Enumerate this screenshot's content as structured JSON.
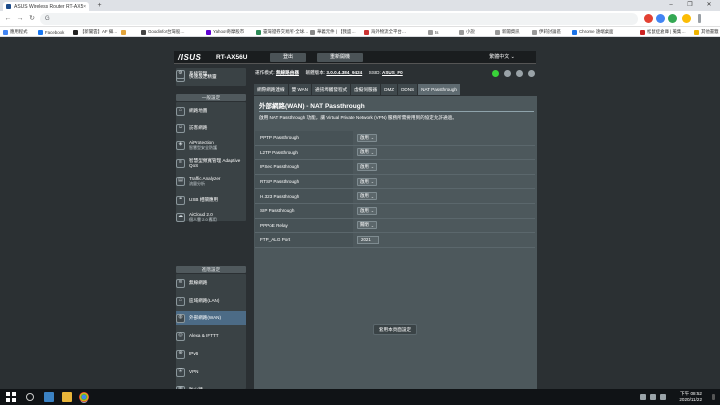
{
  "browser": {
    "tab_title": "ASUS Wireless Router RT-AX5…",
    "tab_close": "×",
    "new_tab": "+",
    "url": "G",
    "window_controls": [
      "–",
      "❐",
      "✕"
    ],
    "nav": {
      "back": "←",
      "forward": "→",
      "reload": "↻"
    },
    "bookmarks": [
      {
        "label": "應用程式",
        "color": "#4285f4"
      },
      {
        "label": "Facebook",
        "color": "#1877f2"
      },
      {
        "label": "【新聞雲】AF 攝…",
        "color": "#222222"
      },
      {
        "label": "",
        "color": "#e2a43b"
      },
      {
        "label": "Goodinfo!台灣股…",
        "color": "#444444"
      },
      {
        "label": "Yahoo!奇摩股市",
        "color": "#6001d2"
      },
      {
        "label": "臺灣證券交易所-全球…",
        "color": "#2e8b57"
      },
      {
        "label": "華義元件 | 【我盛…",
        "color": "#888888"
      },
      {
        "label": "海外物流全平台…",
        "color": "#cc3333"
      },
      {
        "label": "ts",
        "color": "#999999"
      },
      {
        "label": "小說",
        "color": "#999999"
      },
      {
        "label": "新聞資訊",
        "color": "#999999"
      },
      {
        "label": "伊莉討論區",
        "color": "#999999"
      },
      {
        "label": "Chrome 遠端桌面",
        "color": "#1a73e8"
      },
      {
        "label": "松鼠症倉庫 | 蒐集…",
        "color": "#cc2222"
      },
      {
        "label": "其他書籤",
        "color": "#f0b400"
      }
    ]
  },
  "header": {
    "brand": "/ISUS",
    "model": "RT-AX56U",
    "logout": "登出",
    "reboot": "重新開機",
    "language": "繁體中文 ⌄"
  },
  "status": {
    "op_mode_label": "運作模式:",
    "op_mode_value": "無線路由器",
    "fw_label": "韌體版本:",
    "fw_value": "3.0.0.4.384_9424",
    "ssid_label": "SSID:",
    "ssid_value": "ASUS_F0"
  },
  "sidebar": {
    "quick_setup": "快速設定精靈",
    "general_header": "一般設定",
    "general_items": [
      {
        "label": "網路地圖",
        "sub": "",
        "icon": "network-map-icon",
        "glyph": "⌂"
      },
      {
        "label": "訪客網路",
        "sub": "",
        "icon": "guest-network-icon",
        "glyph": "☺"
      },
      {
        "label": "AiProtection",
        "sub": "智慧型安全防護",
        "icon": "shield-icon",
        "glyph": "◈"
      },
      {
        "label": "智慧型頻寬管理 Adaptive QoS",
        "sub": "",
        "icon": "qos-icon",
        "glyph": "≡"
      },
      {
        "label": "Traffic Analyzer",
        "sub": "流量分析",
        "icon": "traffic-analyzer-icon",
        "glyph": "▤"
      },
      {
        "label": "USB 相關應用",
        "sub": "",
        "icon": "usb-icon",
        "glyph": "⚭"
      },
      {
        "label": "AiCloud 2.0",
        "sub": "個人雲 2.0 應用",
        "icon": "cloud-icon",
        "glyph": "☁"
      }
    ],
    "advanced_header": "進階設定",
    "advanced_items": [
      {
        "label": "無線網路",
        "sub": "",
        "icon": "wireless-icon",
        "glyph": "≋",
        "active": false
      },
      {
        "label": "區域網路(LAN)",
        "sub": "",
        "icon": "lan-icon",
        "glyph": "⌂",
        "active": false
      },
      {
        "label": "外部網路(WAN)",
        "sub": "",
        "icon": "wan-icon",
        "glyph": "◍",
        "active": true
      },
      {
        "label": "Alexa & IFTTT",
        "sub": "",
        "icon": "alexa-icon",
        "glyph": "◎",
        "active": false
      },
      {
        "label": "IPv6",
        "sub": "",
        "icon": "ipv6-icon",
        "glyph": "⊕",
        "active": false
      },
      {
        "label": "VPN",
        "sub": "",
        "icon": "vpn-icon",
        "glyph": "⛨",
        "active": false
      },
      {
        "label": "防火牆",
        "sub": "",
        "icon": "firewall-icon",
        "glyph": "▦",
        "active": false
      },
      {
        "label": "系統管理",
        "sub": "",
        "icon": "admin-icon",
        "glyph": "⚙",
        "active": false
      }
    ]
  },
  "subtabs": [
    {
      "label": "網際網路連線",
      "active": false
    },
    {
      "label": "雙 WAN",
      "active": false
    },
    {
      "label": "通訊埠觸發程式",
      "active": false
    },
    {
      "label": "虛擬伺服器",
      "active": false
    },
    {
      "label": "DMZ",
      "active": false
    },
    {
      "label": "DDNS",
      "active": false
    },
    {
      "label": "NAT Passthrough",
      "active": true
    }
  ],
  "panel": {
    "title": "外部網路(WAN) - NAT Passthrough",
    "description": "啟用 NAT Passthrough 功能，讓 Virtual Private Network (VPN) 服務所需要用到的協定允許通過。",
    "settings": [
      {
        "label": "PPTP Passthrough",
        "type": "select",
        "value": "啟用"
      },
      {
        "label": "L2TP Passthrough",
        "type": "select",
        "value": "啟用"
      },
      {
        "label": "IPSec Passthrough",
        "type": "select",
        "value": "啟用"
      },
      {
        "label": "RTSP Passthrough",
        "type": "select",
        "value": "啟用"
      },
      {
        "label": "H.323 Passthrough",
        "type": "select",
        "value": "啟用"
      },
      {
        "label": "SIP Passthrough",
        "type": "select",
        "value": "啟用"
      },
      {
        "label": "PPPoE Relay",
        "type": "select",
        "value": "關閉"
      },
      {
        "label": "FTP_ALG Port",
        "type": "input",
        "value": "2021"
      }
    ],
    "apply": "套用本頁面設定"
  },
  "taskbar": {
    "time": "下午 08:52",
    "date": "2020/11/22"
  },
  "colors": {
    "page_bg": "#2b3033",
    "panel_bg": "#4d585c",
    "active_nav": "#4c6b86"
  }
}
